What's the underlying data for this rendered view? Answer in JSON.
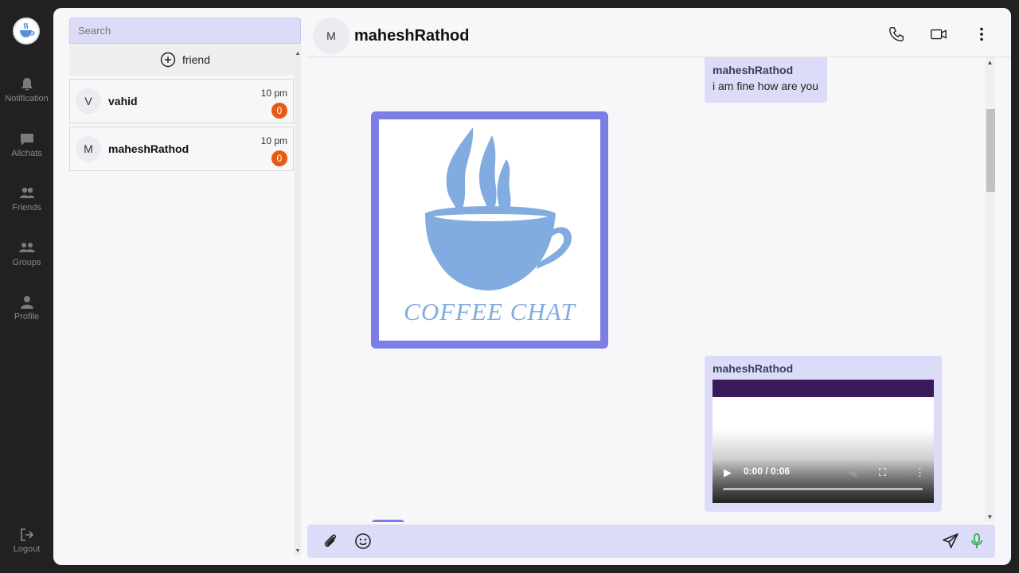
{
  "nav": {
    "items": [
      {
        "label": "Notification",
        "icon": "bell-icon"
      },
      {
        "label": "Allchats",
        "icon": "chat-icon"
      },
      {
        "label": "Friends",
        "icon": "users-icon"
      },
      {
        "label": "Groups",
        "icon": "group-icon"
      },
      {
        "label": "Profile",
        "icon": "user-icon"
      }
    ],
    "logout_label": "Logout"
  },
  "sidebar": {
    "search_placeholder": "Search",
    "add_friend_label": "friend",
    "contacts": [
      {
        "initial": "V",
        "name": "vahid",
        "time": "10 pm",
        "unread": "0"
      },
      {
        "initial": "M",
        "name": "maheshRathod",
        "time": "10 pm",
        "unread": "0"
      }
    ]
  },
  "chat": {
    "header": {
      "initial": "M",
      "title": "maheshRathod"
    },
    "messages": [
      {
        "sender": "maheshRathod",
        "text": "i am fine how are you"
      },
      {
        "type": "image",
        "caption": "COFFEE CHAT"
      },
      {
        "sender": "maheshRathod",
        "type": "video",
        "time_display": "0:00 / 0:06"
      }
    ],
    "composer": {
      "placeholder": ""
    }
  },
  "colors": {
    "accent": "#7d7de6",
    "bubble": "#dcdcf8",
    "badge": "#e65a12",
    "mic": "#2eaa55"
  }
}
